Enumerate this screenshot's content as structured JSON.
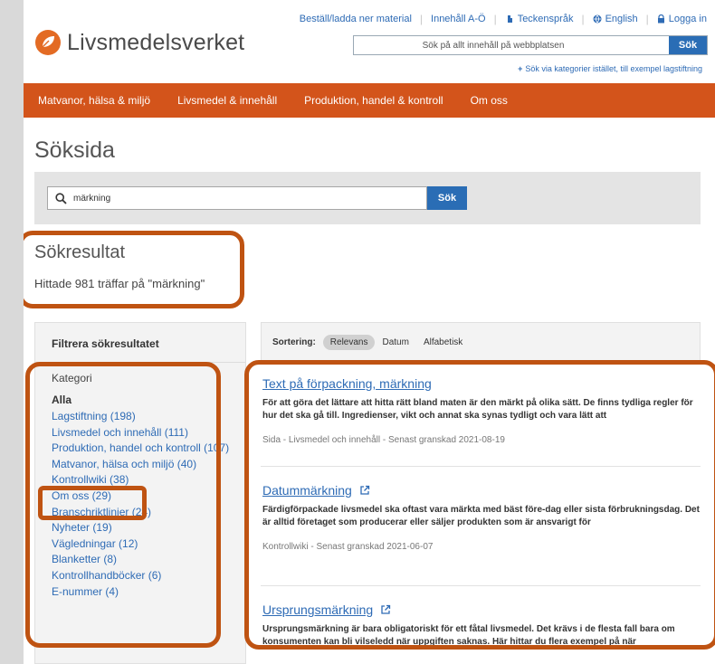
{
  "top_links": [
    {
      "label": "Beställ/ladda ner material",
      "icon": ""
    },
    {
      "label": "Innehåll A-Ö",
      "icon": ""
    },
    {
      "label": "Teckenspråk",
      "icon": "sign-language-icon"
    },
    {
      "label": "English",
      "icon": "globe-icon"
    },
    {
      "label": "Logga in",
      "icon": "lock-icon"
    }
  ],
  "logo": {
    "text": "Livsmedelsverket"
  },
  "site_search": {
    "placeholder": "Sök på allt innehåll på webbplatsen",
    "button": "Sök"
  },
  "category_link": {
    "plus": "+",
    "label": "Sök via kategorier istället, till exempel lagstiftning"
  },
  "main_nav": [
    "Matvanor, hälsa & miljö",
    "Livsmedel & innehåll",
    "Produktion, handel & kontroll",
    "Om oss"
  ],
  "page_title": "Söksida",
  "search": {
    "value": "märkning",
    "button": "Sök"
  },
  "results_header": {
    "title": "Sökresultat",
    "count_text": "Hittade 981 träffar på \"märkning\""
  },
  "filter": {
    "heading": "Filtrera sökresultatet",
    "category_label": "Kategori",
    "all_label": "Alla",
    "items": [
      "Lagstiftning (198)",
      "Livsmedel och innehåll (111)",
      "Produktion, handel och kontroll (107)",
      "Matvanor, hälsa och miljö (40)",
      "Kontrollwiki (38)",
      "Om oss (29)",
      "Branschriktlinjer (24)",
      "Nyheter (19)",
      "Vägledningar (12)",
      "Blanketter (8)",
      "Kontrollhandböcker (6)",
      "E-nummer (4)"
    ]
  },
  "sort": {
    "label": "Sortering:",
    "options": [
      "Relevans",
      "Datum",
      "Alfabetisk"
    ],
    "active": "Relevans"
  },
  "results": [
    {
      "title": "Text på förpackning, märkning",
      "external": false,
      "snippet": "För att göra det lättare att hitta rätt bland maten är den märkt på olika sätt. De finns tydliga regler för hur det ska gå till. Ingredienser, vikt och annat ska synas tydligt och vara lätt att",
      "meta": "Sida - Livsmedel och innehåll - Senast granskad 2021-08-19"
    },
    {
      "title": "Datummärkning",
      "external": true,
      "snippet": "Färdigförpackade livsmedel ska oftast vara märkta med bäst före-dag eller sista förbrukningsdag. Det är alltid företaget som producerar eller säljer produkten som är ansvarigt för",
      "meta": "Kontrollwiki - Senast granskad 2021-06-07"
    },
    {
      "title": "Ursprungsmärkning",
      "external": true,
      "snippet": "Ursprungsmärkning är bara obligatoriskt för ett fåtal livsmedel. Det krävs i de flesta fall bara om konsumenten kan bli vilseledd när uppgiften saknas. Här hittar du flera exempel på när",
      "meta": ""
    }
  ],
  "colors": {
    "brand_orange": "#d3541b",
    "link_blue": "#2e6bb5",
    "highlight": "#bf5312"
  }
}
